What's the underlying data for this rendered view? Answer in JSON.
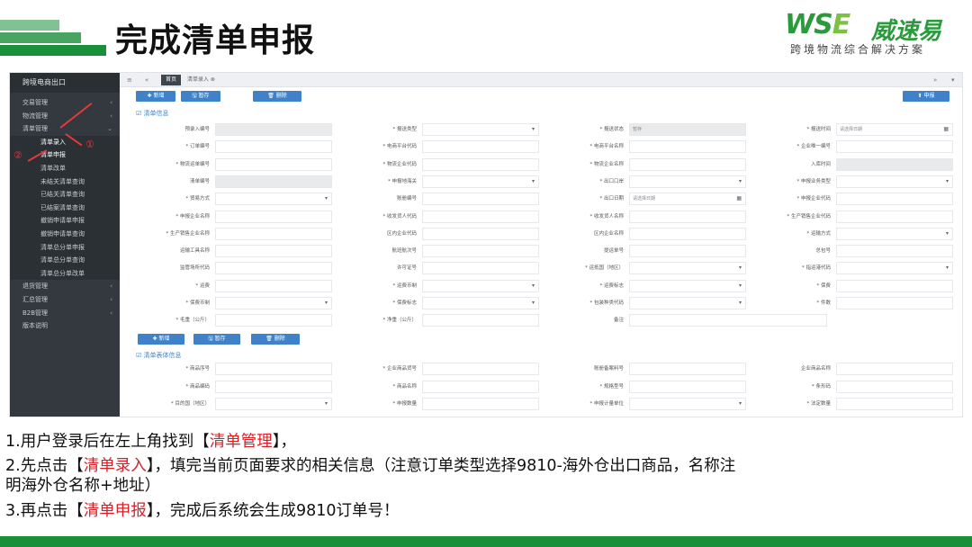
{
  "slide": {
    "title": "完成清单申报",
    "logo": {
      "word_a": "WS",
      "word_b": "E",
      "cn": "威速易",
      "slogan": "跨境物流综合解决方案"
    },
    "colors": {
      "brand": "#1a8f3a",
      "highlight": "#d81f26",
      "button": "#3f82c9"
    }
  },
  "app": {
    "brand": "跨境电商出口",
    "menu": [
      {
        "label": "交易管理",
        "chev": "‹"
      },
      {
        "label": "物流管理",
        "chev": "‹"
      },
      {
        "label": "清单管理",
        "chev": "⌄"
      }
    ],
    "submenu": [
      "清单录入",
      "清单申报",
      "清单改单",
      "未结关清单查询",
      "已结关清单查询",
      "已结案清单查询",
      "撤销申请单申报",
      "撤销申请单查询",
      "清单总分单申报",
      "清单总分单查询",
      "清单总分单改单"
    ],
    "menu_after": [
      {
        "label": "退货管理",
        "chev": "‹"
      },
      {
        "label": "汇总管理",
        "chev": "‹"
      },
      {
        "label": "B2B管理",
        "chev": "‹"
      },
      {
        "label": "版本说明",
        "chev": ""
      }
    ],
    "tabs": {
      "home": "首页",
      "current": "清单录入 ⊗"
    },
    "toolbar": {
      "add": "✚ 新增",
      "save": "🖫 暂存",
      "delete": "🗑 删除",
      "declare": "⬆ 申报"
    },
    "section_list": "☑ 清单信息",
    "section_goods": "☑ 清单表体信息",
    "fields": [
      [
        "预录入编号",
        "",
        "ro",
        "* 报送类型",
        "",
        "dd",
        "* 报送状态",
        "暂存",
        "ro",
        "* 报送时间",
        "请选择日期",
        "cal"
      ],
      [
        "* 订单编号",
        "",
        "",
        "* 电商平台代码",
        "",
        "",
        "* 电商平台名称",
        "",
        "",
        "* 企业唯一编号",
        "",
        ""
      ],
      [
        "* 物流运单编号",
        "",
        "",
        "* 物流企业代码",
        "",
        "",
        "* 物流企业名称",
        "",
        "",
        "入库时间",
        "",
        "ro"
      ],
      [
        "清单编号",
        "",
        "ro",
        "* 申报地海关",
        "",
        "dd",
        "* 出口口岸",
        "",
        "dd",
        "* 申报业务类型",
        "",
        "dd"
      ],
      [
        "* 贸易方式",
        "",
        "dd",
        "账册编号",
        "",
        "",
        "* 出口日期",
        "请选择日期",
        "cal",
        "* 申报企业代码",
        "",
        ""
      ],
      [
        "* 申报企业名称",
        "",
        "",
        "* 收发货人代码",
        "",
        "",
        "* 收发货人名称",
        "",
        "",
        "* 生产销售企业代码",
        "",
        ""
      ],
      [
        "* 生产销售企业名称",
        "",
        "",
        "区内企业代码",
        "",
        "",
        "区内企业名称",
        "",
        "",
        "* 运输方式",
        "",
        "dd"
      ],
      [
        "运输工具名称",
        "",
        "",
        "航班航次号",
        "",
        "",
        "提运单号",
        "",
        "",
        "总包号",
        "",
        ""
      ],
      [
        "监管场所代码",
        "",
        "",
        "许可证号",
        "",
        "",
        "* 运抵国（地区）",
        "",
        "dd",
        "* 指运港代码",
        "",
        "dd"
      ],
      [
        "* 运费",
        "",
        "",
        "* 运费币制",
        "",
        "dd",
        "* 运费标志",
        "",
        "dd",
        "* 保费",
        "",
        ""
      ],
      [
        "* 保费币制",
        "",
        "dd",
        "* 保费标志",
        "",
        "dd",
        "* 包装种类代码",
        "",
        "dd",
        "* 件数",
        "",
        ""
      ],
      [
        "* 毛重（公斤）",
        "",
        "",
        "* 净重（公斤）",
        "",
        "",
        "备注",
        "",
        "",
        "",
        "",
        ""
      ]
    ],
    "goods_fields": [
      [
        "* 商品序号",
        "",
        "",
        "* 企业商品货号",
        "",
        "",
        "账册备案料号",
        "",
        "",
        "企业商品名称",
        "",
        ""
      ],
      [
        "* 商品编码",
        "",
        "",
        "* 商品名称",
        "",
        "",
        "* 规格型号",
        "",
        "",
        "* 条形码",
        "",
        ""
      ],
      [
        "* 目的国（地区）",
        "",
        "dd",
        "* 申报数量",
        "",
        "",
        "* 申报计量单位",
        "",
        "dd",
        "* 法定数量",
        "",
        ""
      ]
    ]
  },
  "annotations": {
    "one": "①",
    "two": "②"
  },
  "instructions": {
    "l1a": "1.用户登录后在左上角找到【",
    "l1b": "清单管理",
    "l1c": "】，",
    "l2a": "2.先点击【",
    "l2b": "清单录入",
    "l2c": "】，填完当前页面要求的相关信息（注意订单类型选择9810-海外仓出口商品，名称注",
    "l2d": "明海外仓名称+地址）",
    "l3a": "3.再点击【",
    "l3b": "清单申报",
    "l3c": "】，完成后系统会生成9810订单号！"
  }
}
